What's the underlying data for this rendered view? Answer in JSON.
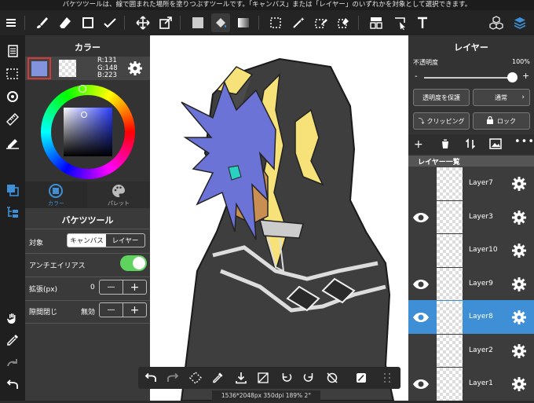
{
  "status_message": "バケツツールは、線で囲まれた場所を塗りつぶすツールです。「キャンバス」または「レイヤー」のいずれかを対象として選択できます。",
  "color_panel": {
    "title": "カラー",
    "r": "R:131",
    "g": "G:148",
    "b": "B:223",
    "tab_color": "カラー",
    "tab_palette": "パレット",
    "main_color": "#8394df"
  },
  "bucket_panel": {
    "title": "バケツツール",
    "target_label": "対象",
    "target_canvas": "キャンバス",
    "target_layer": "レイヤー",
    "antialias_label": "アンチエイリアス",
    "expand_label": "拡張(px)",
    "expand_value": "0",
    "gap_label": "隙間閉じ",
    "gap_value": "無効",
    "minus": "—",
    "plus": "+"
  },
  "layer_panel": {
    "title": "レイヤー",
    "opacity_label": "不透明度",
    "opacity_value": "100%",
    "slider_minus": "-",
    "slider_plus": "+",
    "protect_alpha": "透明度を保護",
    "blend_mode": "通常",
    "clipping": "クリッピング",
    "lock": "ロック",
    "list_title": "レイヤー一覧",
    "layers": [
      {
        "name": "Layer7",
        "visible": false
      },
      {
        "name": "Layer3",
        "visible": true
      },
      {
        "name": "Layer10",
        "visible": false
      },
      {
        "name": "Layer9",
        "visible": true
      },
      {
        "name": "Layer8",
        "visible": true,
        "selected": true
      },
      {
        "name": "Layer2",
        "visible": false
      },
      {
        "name": "Layer1",
        "visible": true
      }
    ]
  },
  "canvas_info": "1536*2048px 350dpi 189% 2°",
  "colors": {
    "accent": "#3f8fd6",
    "toggle_on": "#5ed45e",
    "hair": "#6b74d6",
    "hood": "#3e3e3e",
    "yellow": "#f7e27a"
  }
}
